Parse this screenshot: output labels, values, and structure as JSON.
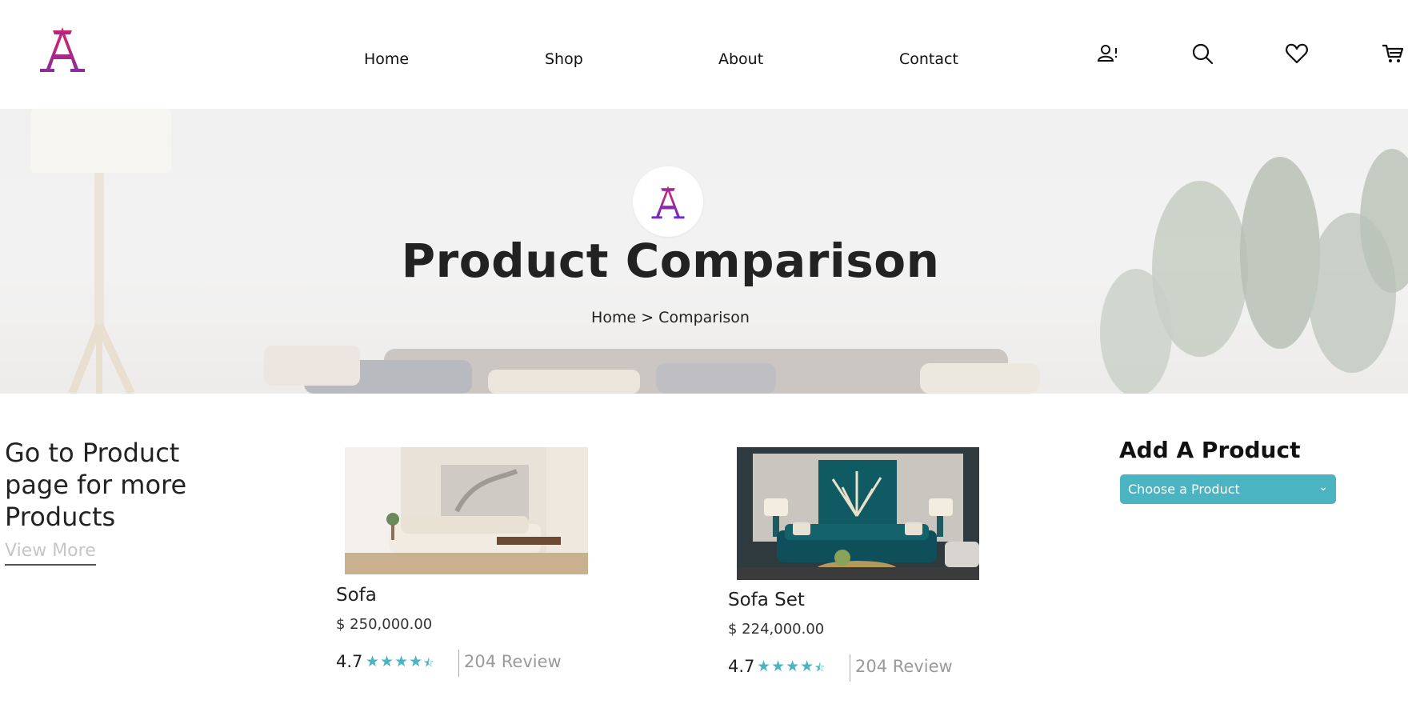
{
  "nav": {
    "items": [
      {
        "label": "Home"
      },
      {
        "label": "Shop"
      },
      {
        "label": "About"
      },
      {
        "label": "Contact"
      }
    ],
    "icons": [
      "account-icon",
      "search-icon",
      "heart-icon",
      "cart-icon"
    ]
  },
  "hero": {
    "title": "Product Comparison",
    "breadcrumb": {
      "home": "Home",
      "separator": ">",
      "current": "Comparison"
    }
  },
  "promo": {
    "heading": "Go to Product page for more Products",
    "link": "View More"
  },
  "products": [
    {
      "name": "Sofa",
      "price": "$ 250,000.00",
      "rating": "4.7",
      "stars": "★★★★",
      "half_star": "⯪",
      "review": "204 Review"
    },
    {
      "name": "Sofa Set",
      "price": "$ 224,000.00",
      "rating": "4.7",
      "stars": "★★★★",
      "half_star": "⯪",
      "review": "204 Review"
    }
  ],
  "add_product": {
    "heading": "Add A Product",
    "select_value": "Choose a Product"
  },
  "colors": {
    "accent": "#4ab4c2",
    "logo_top": "#e0245e",
    "logo_bottom": "#7b2cbf"
  }
}
